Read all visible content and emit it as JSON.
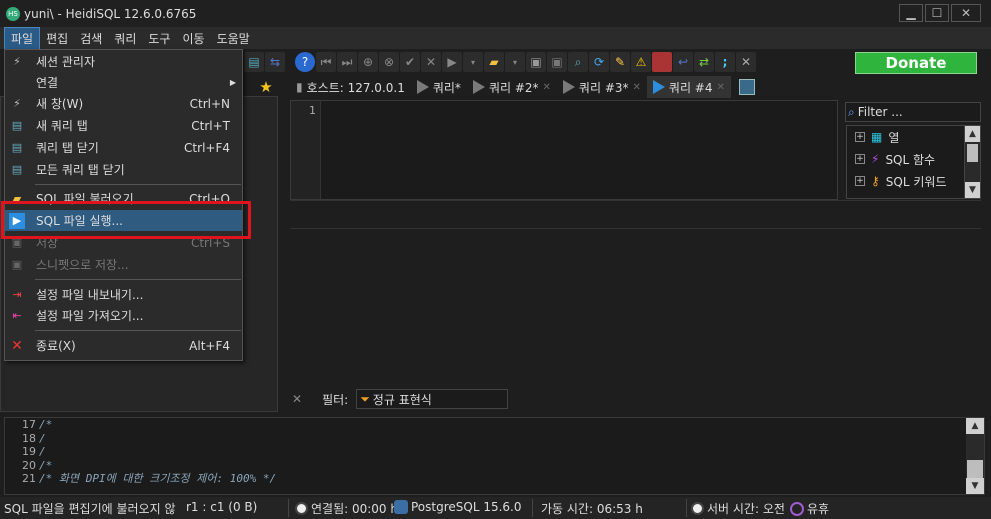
{
  "window": {
    "title": "yuni\\ - HeidiSQL 12.6.0.6765",
    "app_icon_text": "HS",
    "minimize": "▁",
    "maximize": "☐",
    "close": "✕"
  },
  "menu": [
    "파일",
    "편집",
    "검색",
    "쿼리",
    "도구",
    "이동",
    "도움말"
  ],
  "donate_label": "Donate",
  "tabs": [
    {
      "label": "호스트: 127.0.0.1"
    },
    {
      "label": "쿼리*"
    },
    {
      "label": "쿼리 #2*"
    },
    {
      "label": "쿼리 #3*"
    },
    {
      "label": "쿼리 #4"
    }
  ],
  "tab_close": "✕",
  "editor": {
    "line1": "1"
  },
  "filter_placeholder": "Filter ...",
  "helpers": [
    {
      "label": "열",
      "icon": "grid-icon",
      "color": "#2ec4e0"
    },
    {
      "label": "SQL 함수",
      "icon": "lightning-icon",
      "color": "#b04ee0"
    },
    {
      "label": "SQL 키워드",
      "icon": "key-icon",
      "color": "#f0a020"
    }
  ],
  "filter_row": {
    "label": "필터:",
    "regex": "정규 표현식"
  },
  "file_menu": {
    "items": [
      {
        "label": "세션 관리자",
        "shortcut": "",
        "icon": "plug-icon",
        "disabled": false
      },
      {
        "label": "연결",
        "shortcut": "",
        "icon": "",
        "disabled": false,
        "submenu": true
      },
      {
        "label": "새 창(W)",
        "shortcut": "Ctrl+N",
        "icon": "plug-icon",
        "disabled": false
      },
      {
        "label": "새 쿼리 탭",
        "shortcut": "Ctrl+T",
        "icon": "new-tab-icon",
        "disabled": false
      },
      {
        "label": "쿼리 탭 닫기",
        "shortcut": "Ctrl+F4",
        "icon": "close-tab-icon",
        "disabled": false
      },
      {
        "label": "모든 쿼리 탭 닫기",
        "shortcut": "",
        "icon": "close-all-tabs-icon",
        "disabled": false
      },
      {
        "label": "SQL 파일 불러오기...",
        "shortcut": "Ctrl+O",
        "icon": "folder-icon",
        "disabled": false
      },
      {
        "label": "SQL 파일 실행...",
        "shortcut": "",
        "icon": "play-icon",
        "disabled": false,
        "highlight": true
      },
      {
        "label": "저장",
        "shortcut": "Ctrl+S",
        "icon": "save-icon",
        "disabled": true
      },
      {
        "label": "스니펫으로 저장...",
        "shortcut": "",
        "icon": "save-snippet-icon",
        "disabled": true
      },
      {
        "label": "설정 파일 내보내기...",
        "shortcut": "",
        "icon": "export-icon",
        "disabled": false
      },
      {
        "label": "설정 파일 가져오기...",
        "shortcut": "",
        "icon": "import-icon",
        "disabled": false
      },
      {
        "label": "종료(X)",
        "shortcut": "Alt+F4",
        "icon": "exit-icon",
        "disabled": false
      }
    ]
  },
  "log": {
    "line_numbers": [
      "17",
      "18",
      "19",
      "20",
      "21"
    ],
    "lines": [
      "/*",
      "/",
      "/",
      "/*",
      "/* 화면 DPI에 대한 크기조정 제어: 100% */"
    ]
  },
  "status": {
    "message": "SQL 파일을 편집기에 불러오지 않",
    "position": "r1 : c1 (0 B)",
    "connected": "연결됨: 00:00 h",
    "server": "PostgreSQL 15.6.0",
    "uptime": "가동 시간: 06:53 h",
    "server_time": "서버 시간: 오전",
    "idle": "유휴"
  },
  "colors": {
    "accent": "#2f5b80",
    "donate": "#2fb53e",
    "highlight_border": "#e0141e"
  }
}
